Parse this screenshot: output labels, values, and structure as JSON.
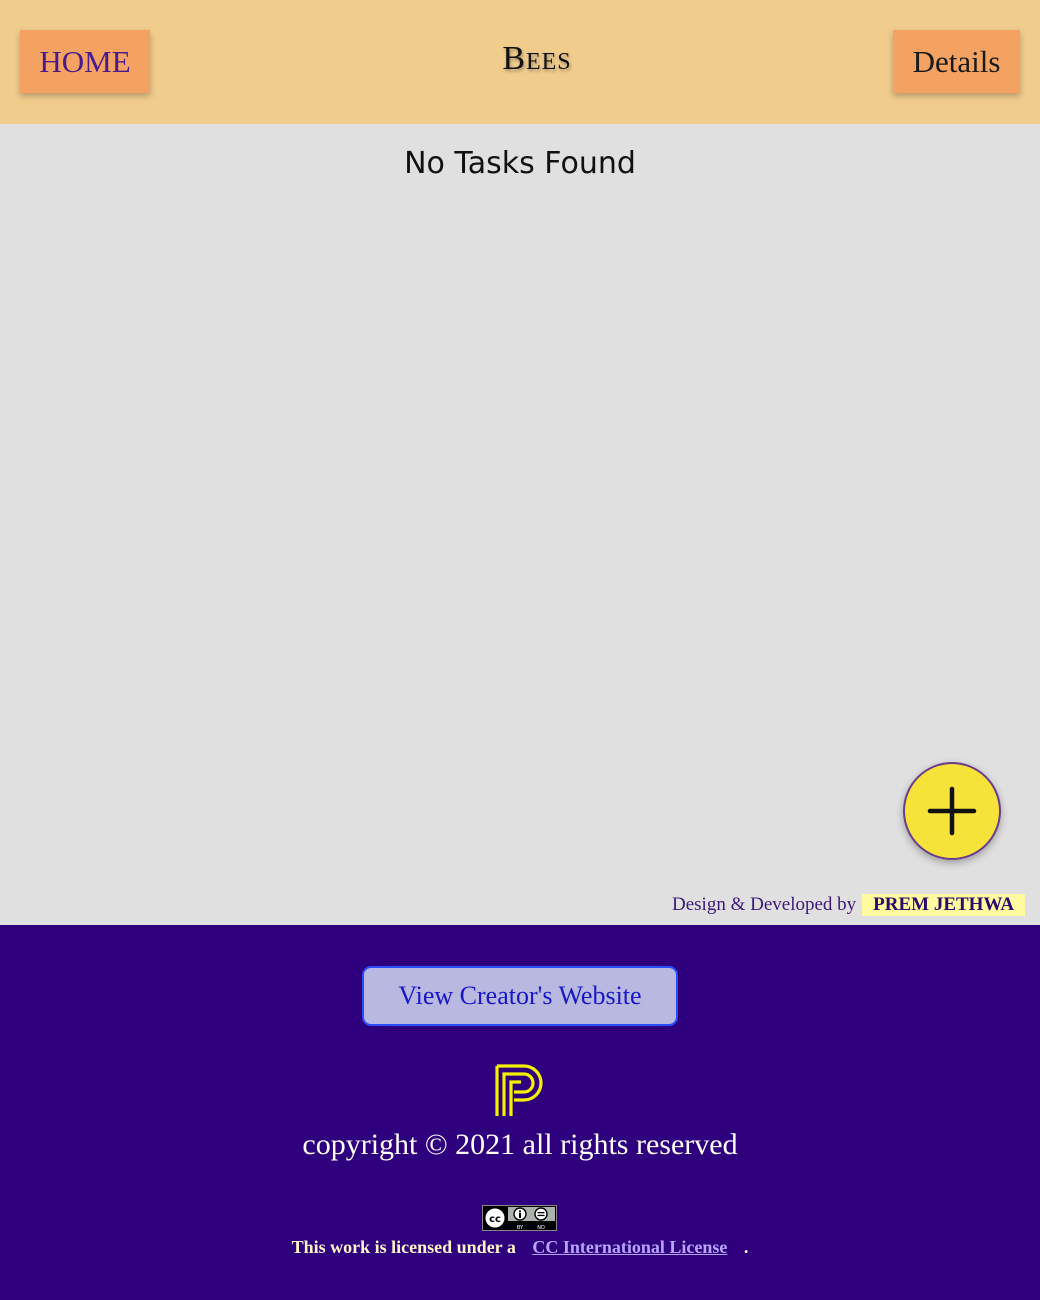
{
  "header": {
    "home_label": "HOME",
    "title": "Bees",
    "details_label": "Details"
  },
  "main": {
    "empty_message": "No Tasks Found",
    "fab_icon": "plus-icon"
  },
  "credit": {
    "prefix": "Design & Developed by",
    "name": "PREM JETHWA"
  },
  "footer": {
    "website_button_label": "View Creator's Website",
    "logo_icon": "pj-monogram-logo",
    "copyright": "copyright © 2021 all rights reserved",
    "license_prefix": "This work is licensed under a",
    "license_link": "CC International License",
    "license_suffix": ".",
    "cc_badge_icon": "cc-by-nd-badge",
    "cc_badge_text": {
      "by": "BY",
      "nd": "ND"
    }
  },
  "colors": {
    "header_bg": "#f0cc8d",
    "nav_button_bg": "#f4a261",
    "main_bg": "#e0e0e0",
    "fab_bg": "#f6e33a",
    "footer_bg": "#2e007d",
    "logo_color": "#f5f000"
  }
}
